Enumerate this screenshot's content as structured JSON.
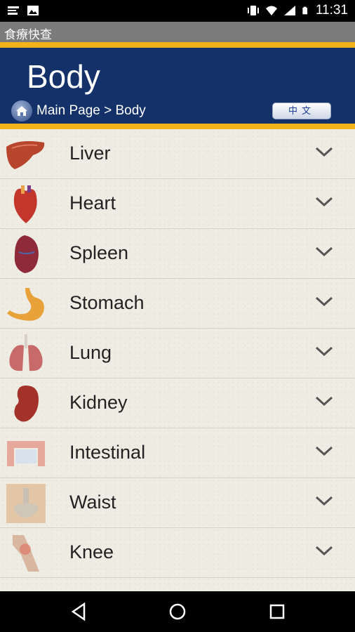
{
  "status_bar": {
    "time": "11:31"
  },
  "app": {
    "title": "食療快查"
  },
  "header": {
    "title": "Body",
    "breadcrumb": "Main Page > Body",
    "lang_button": "中文"
  },
  "list": [
    {
      "label": "Liver",
      "icon": "liver-icon",
      "color": "#b8452e"
    },
    {
      "label": "Heart",
      "icon": "heart-icon",
      "color": "#c2362c"
    },
    {
      "label": "Spleen",
      "icon": "spleen-icon",
      "color": "#8e2a3a"
    },
    {
      "label": "Stomach",
      "icon": "stomach-icon",
      "color": "#e9a23a"
    },
    {
      "label": "Lung",
      "icon": "lung-icon",
      "color": "#c96a6a"
    },
    {
      "label": "Kidney",
      "icon": "kidney-icon",
      "color": "#a3322b"
    },
    {
      "label": "Intestinal",
      "icon": "intestinal-icon",
      "color": "#e6a89b"
    },
    {
      "label": "Waist",
      "icon": "waist-icon",
      "color": "#e2c6a5"
    },
    {
      "label": "Knee",
      "icon": "knee-icon",
      "color": "#d9b6a0"
    }
  ],
  "colors": {
    "header_blue": "#14316a",
    "accent_gold": "#f2b31a",
    "appbar_gray": "#7b7b7b"
  }
}
